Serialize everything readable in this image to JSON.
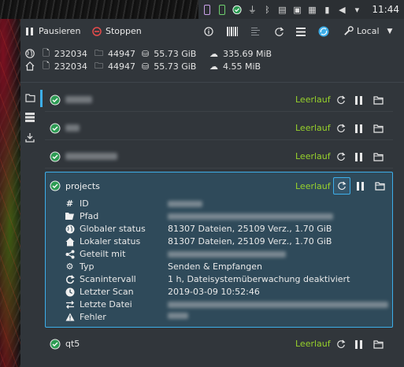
{
  "tray": {
    "clock": "11:44"
  },
  "toolbar": {
    "pause_label": "Pausieren",
    "stop_label": "Stoppen",
    "device_label": "Local"
  },
  "stats": {
    "global": {
      "files": "232034",
      "folders": "44947",
      "size": "55.73 GiB",
      "download": "335.69 MiB"
    },
    "local": {
      "files": "232034",
      "folders": "44947",
      "size": "55.73 GiB",
      "download": "4.55 MiB"
    }
  },
  "folders": [
    {
      "name": "",
      "status": "Leerlauf"
    },
    {
      "name": "",
      "status": "Leerlauf"
    },
    {
      "name": "",
      "status": "Leerlauf"
    }
  ],
  "expanded": {
    "name": "projects",
    "status": "Leerlauf",
    "details": [
      {
        "label": "ID",
        "value": ""
      },
      {
        "label": "Pfad",
        "value": ""
      },
      {
        "label": "Globaler status",
        "value": "81307 Dateien, 25109 Verz., 1.70 GiB"
      },
      {
        "label": "Lokaler status",
        "value": "81307 Dateien, 25109 Verz., 1.70 GiB"
      },
      {
        "label": "Geteilt mit",
        "value": ""
      },
      {
        "label": "Typ",
        "value": "Senden & Empfangen"
      },
      {
        "label": "Scanintervall",
        "value": "1 h, Dateisystemüberwachung deaktiviert"
      },
      {
        "label": "Letzter Scan",
        "value": "2019-03-09 10:52:46"
      },
      {
        "label": "Letzte Datei",
        "value": ""
      },
      {
        "label": "Fehler",
        "value": ""
      }
    ]
  },
  "bottom_folder": {
    "name": "qt5",
    "status": "Leerlauf"
  },
  "colors": {
    "accent": "#3daee9",
    "idle_status": "#97d12b",
    "window_bg": "#31363b",
    "expanded_bg": "#2f4a5a"
  }
}
